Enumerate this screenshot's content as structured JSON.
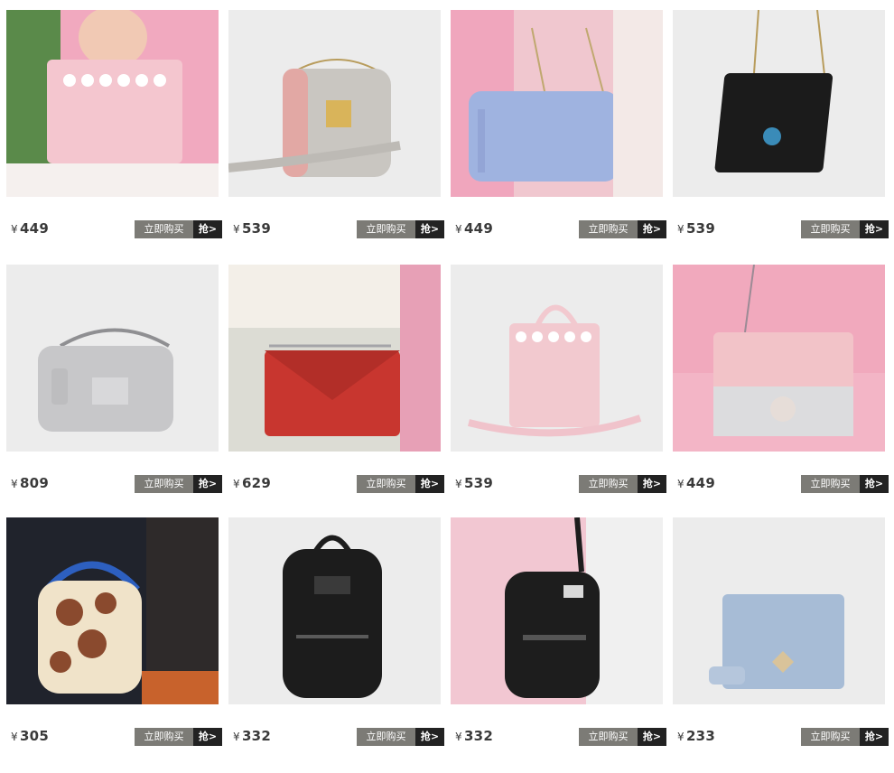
{
  "currency_symbol": "¥",
  "buy_label": "立即购买",
  "grab_label": "抢>",
  "products": [
    {
      "price": "449",
      "bg": "#f1a9bf",
      "bag": "#f4c6cf",
      "kind": "flower-clutch"
    },
    {
      "price": "539",
      "bg": "#ececec",
      "bag": "#c9c6c1",
      "kind": "lock-bag"
    },
    {
      "price": "449",
      "bg": "#f0c7cf",
      "bag": "#9fb3e0",
      "kind": "camera-bag"
    },
    {
      "price": "539",
      "bg": "#ececec",
      "bag": "#1b1b1b",
      "kind": "chain-bag"
    },
    {
      "price": "809",
      "bg": "#ececec",
      "bag": "#c7c7c9",
      "kind": "glitter-bag"
    },
    {
      "price": "629",
      "bg": "#dcdcd4",
      "bag": "#c8362f",
      "kind": "envelope-bag"
    },
    {
      "price": "539",
      "bg": "#ececec",
      "bag": "#f2c9cf",
      "kind": "tote-bag"
    },
    {
      "price": "449",
      "bg": "#f3b5c6",
      "bag": "#f2c3c8",
      "kind": "pink-flap-bag"
    },
    {
      "price": "305",
      "bg": "#20232c",
      "bag": "#8a4a2e",
      "kind": "print-backpack"
    },
    {
      "price": "332",
      "bg": "#ececec",
      "bag": "#1c1c1c",
      "kind": "black-backpack"
    },
    {
      "price": "332",
      "bg": "#f2c7d2",
      "bag": "#1d1d1d",
      "kind": "mini-backpack"
    },
    {
      "price": "233",
      "bg": "#ececec",
      "bag": "#a7bcd6",
      "kind": "wallet"
    }
  ]
}
